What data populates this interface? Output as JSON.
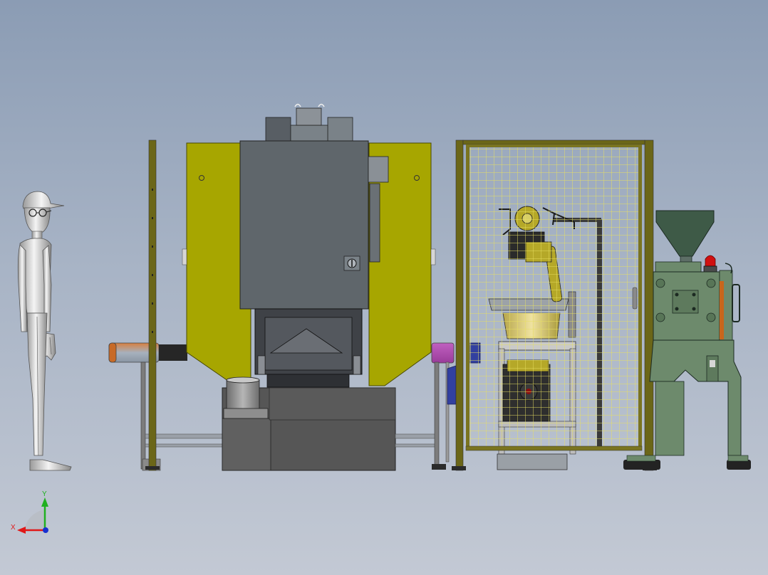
{
  "triad": {
    "x_label": "X",
    "y_label": "Y",
    "x_color": "#e01818",
    "y_color": "#20b020",
    "z_color": "#1830d0"
  },
  "colors": {
    "background_top": "#8b9cb4",
    "background_bottom": "#c3c9d4",
    "press_guard": "#a7a600",
    "press_body": "#5f666b",
    "press_base": "#565656",
    "cell_frame": "#6b6618",
    "mesh": "#e8e060",
    "robot": "#b5a828",
    "molding_machine": "#6d8a6c",
    "hopper": "#3e5a47",
    "conveyor_belt": "#262626",
    "roller_left": "#c8661c",
    "roller_right": "#b048b0",
    "warning_light": "#d01010"
  }
}
